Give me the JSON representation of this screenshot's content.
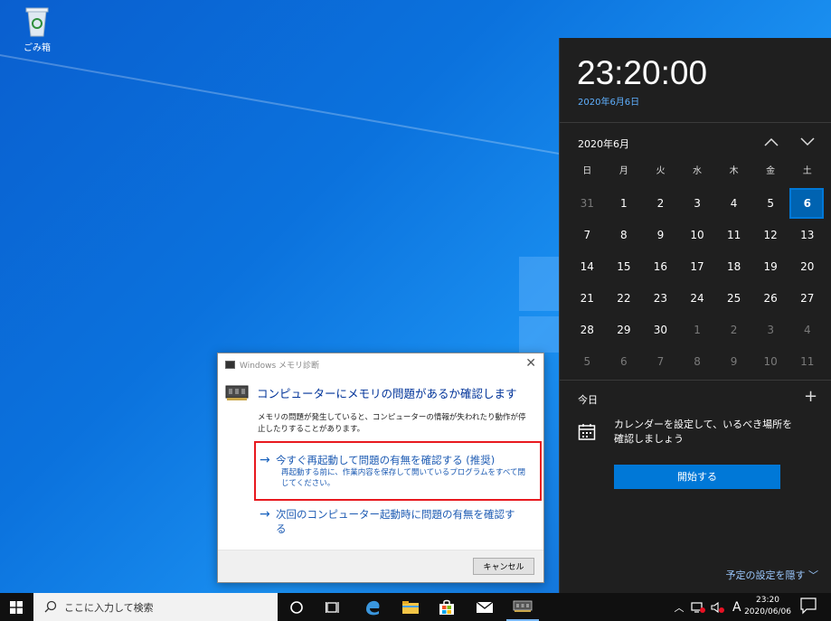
{
  "desktop": {
    "recycle_bin_label": "ごみ箱"
  },
  "dialog": {
    "title": "Windows メモリ診断",
    "heading": "コンピューターにメモリの問題があるか確認します",
    "description": "メモリの問題が発生していると、コンピューターの情報が失われたり動作が停止したりすることがあります。",
    "option1_title": "今すぐ再起動して問題の有無を確認する (推奨)",
    "option1_detail": "再起動する前に、作業内容を保存して開いているプログラムをすべて閉じてください。",
    "option2_title": "次回のコンピューター起動時に問題の有無を確認する",
    "cancel_label": "キャンセル"
  },
  "flyout": {
    "time": "23:20:00",
    "date": "2020年6月6日",
    "month_label": "2020年6月",
    "weekdays": [
      "日",
      "月",
      "火",
      "水",
      "木",
      "金",
      "土"
    ],
    "weeks": [
      [
        "31",
        "1",
        "2",
        "3",
        "4",
        "5",
        "6"
      ],
      [
        "7",
        "8",
        "9",
        "10",
        "11",
        "12",
        "13"
      ],
      [
        "14",
        "15",
        "16",
        "17",
        "18",
        "19",
        "20"
      ],
      [
        "21",
        "22",
        "23",
        "24",
        "25",
        "26",
        "27"
      ],
      [
        "28",
        "29",
        "30",
        "1",
        "2",
        "3",
        "4"
      ],
      [
        "5",
        "6",
        "7",
        "8",
        "9",
        "10",
        "11"
      ]
    ],
    "today": "6",
    "agenda_title": "今日",
    "agenda_text": "カレンダーを設定して、いるべき場所を確認しましょう",
    "start_button": "開始する",
    "hide_schedule": "予定の設定を隠す"
  },
  "taskbar": {
    "search_placeholder": "ここに入力して検索",
    "ime_label": "A",
    "clock_time": "23:20",
    "clock_date": "2020/06/06"
  },
  "colors": {
    "accent": "#0078d7",
    "highlight_box": "#e8191f",
    "link": "#1d5bb3"
  }
}
